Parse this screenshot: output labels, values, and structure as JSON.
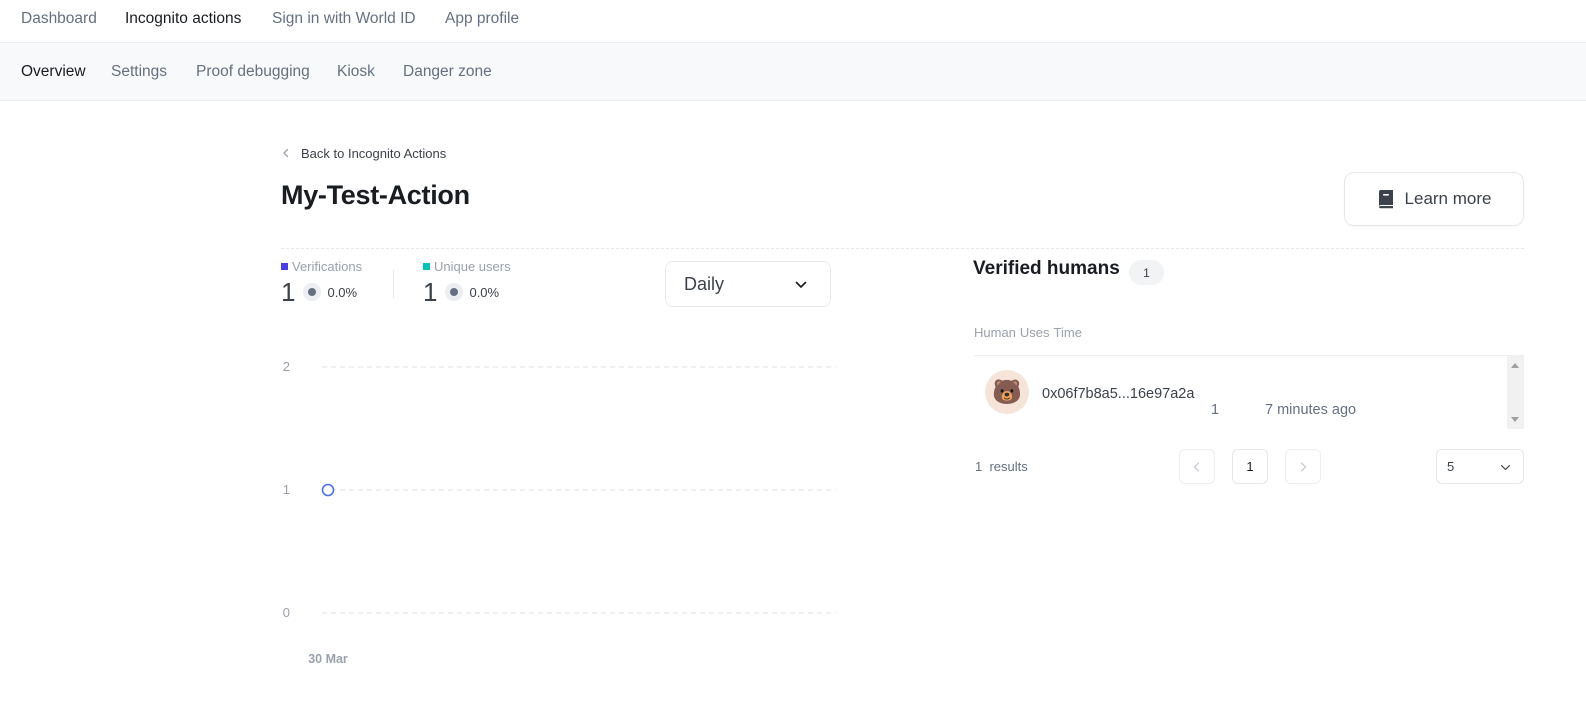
{
  "top_nav": {
    "items": [
      {
        "label": "Dashboard",
        "active": false
      },
      {
        "label": "Incognito actions",
        "active": true
      },
      {
        "label": "Sign in with World ID",
        "active": false
      },
      {
        "label": "App profile",
        "active": false
      }
    ]
  },
  "sub_nav": {
    "items": [
      {
        "label": "Overview",
        "active": true
      },
      {
        "label": "Settings",
        "active": false
      },
      {
        "label": "Proof debugging",
        "active": false
      },
      {
        "label": "Kiosk",
        "active": false
      },
      {
        "label": "Danger zone",
        "active": false
      }
    ]
  },
  "back_link": {
    "label": "Back to Incognito Actions",
    "icon": "chevron-left-icon"
  },
  "page_title": "My-Test-Action",
  "learn_more": {
    "label": "Learn more",
    "icon": "book-icon"
  },
  "stats": {
    "verifications": {
      "label": "Verifications",
      "value": "1",
      "change": "0.0%",
      "color": "#4940e0"
    },
    "unique_users": {
      "label": "Unique users",
      "value": "1",
      "change": "0.0%",
      "color": "#00c3b6"
    }
  },
  "period_select": {
    "value": "Daily"
  },
  "chart_data": {
    "type": "line",
    "x": [
      "30 Mar"
    ],
    "series": [
      {
        "name": "Verifications",
        "values": [
          1
        ],
        "color": "#4940e0"
      }
    ],
    "y_ticks": [
      "2",
      "1",
      "0"
    ],
    "ylim": [
      0,
      2
    ],
    "grid": true
  },
  "verified_humans": {
    "title": "Verified humans",
    "count": "1",
    "columns": [
      "Human",
      "Uses",
      "Time"
    ],
    "rows": [
      {
        "avatar": "🐻",
        "human": "0x06f7b8a5...16e97a2a",
        "uses": "1",
        "time": "7 minutes ago"
      }
    ]
  },
  "pagination": {
    "results_count": "1",
    "results_label": "results",
    "current_page": "1",
    "per_page": "5"
  },
  "colors": {
    "accent": "#4940e0",
    "teal": "#00c3b6",
    "text_dark": "#191c20",
    "text_muted": "#657080"
  }
}
